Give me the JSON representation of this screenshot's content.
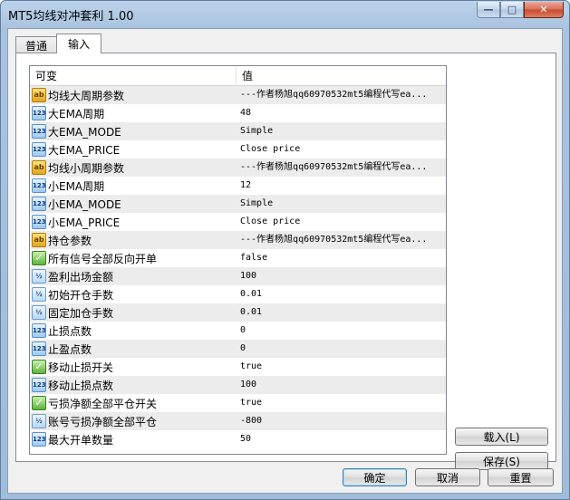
{
  "window": {
    "title": "MT5均线对冲套利 1.00"
  },
  "caption": {
    "minimize": "—",
    "maximize": "□",
    "close": "✕"
  },
  "tabs": [
    {
      "label": "普通"
    },
    {
      "label": "输入"
    }
  ],
  "grid": {
    "headers": {
      "name": "可变",
      "value": "值"
    },
    "rows": [
      {
        "icon": "ab",
        "name": "均线大周期参数",
        "value": "---作者杨旭qq60970532mt5编程代写ea..."
      },
      {
        "icon": "123",
        "name": "大EMA周期",
        "value": "48"
      },
      {
        "icon": "123",
        "name": "大EMA_MODE",
        "value": "Simple"
      },
      {
        "icon": "123",
        "name": "大EMA_PRICE",
        "value": "Close price"
      },
      {
        "icon": "ab",
        "name": "均线小周期参数",
        "value": "---作者杨旭qq60970532mt5编程代写ea..."
      },
      {
        "icon": "123",
        "name": "小EMA周期",
        "value": "12"
      },
      {
        "icon": "123",
        "name": "小EMA_MODE",
        "value": "Simple"
      },
      {
        "icon": "123",
        "name": "小EMA_PRICE",
        "value": "Close price"
      },
      {
        "icon": "ab",
        "name": "持仓参数",
        "value": "---作者杨旭qq60970532mt5编程代写ea..."
      },
      {
        "icon": "bool",
        "name": "所有信号全部反向开单",
        "value": "false"
      },
      {
        "icon": "frac",
        "name": "盈利出场金额",
        "value": "100"
      },
      {
        "icon": "frac",
        "name": "初始开仓手数",
        "value": "0.01"
      },
      {
        "icon": "frac",
        "name": "固定加仓手数",
        "value": "0.01"
      },
      {
        "icon": "123",
        "name": "止损点数",
        "value": "0"
      },
      {
        "icon": "123",
        "name": "止盈点数",
        "value": "0"
      },
      {
        "icon": "bool",
        "name": "移动止损开关",
        "value": "true"
      },
      {
        "icon": "123",
        "name": "移动止损点数",
        "value": "100"
      },
      {
        "icon": "bool",
        "name": "亏损净额全部平仓开关",
        "value": "true"
      },
      {
        "icon": "frac",
        "name": "账号亏损净额全部平仓",
        "value": "-800"
      },
      {
        "icon": "123",
        "name": "最大开单数量",
        "value": "50"
      }
    ]
  },
  "side_buttons": {
    "load": "载入(L)",
    "save": "保存(S)"
  },
  "bottom_buttons": {
    "ok": "确定",
    "cancel": "取消",
    "reset": "重置"
  },
  "icon_glyphs": {
    "ab": "ab",
    "123": "123",
    "bool": "✓",
    "frac": "½"
  }
}
